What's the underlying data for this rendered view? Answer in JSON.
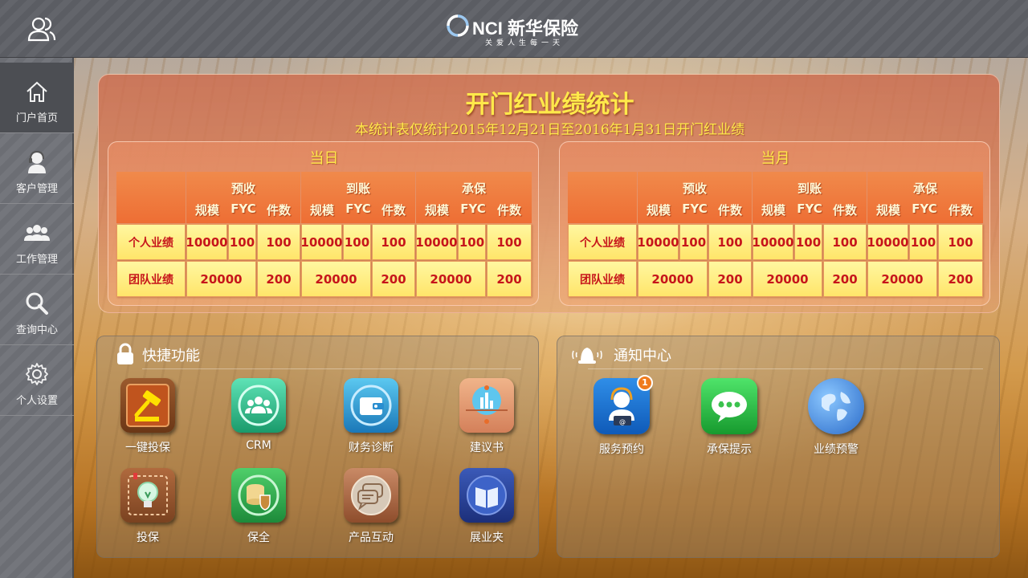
{
  "header": {
    "logo_text": "NCI 新华保险",
    "logo_tagline": "关爱人生每一天"
  },
  "sidebar": {
    "items": [
      {
        "label": "门户首页",
        "icon": "home-icon",
        "active": true
      },
      {
        "label": "客户管理",
        "icon": "customer-service-icon",
        "active": false
      },
      {
        "label": "工作管理",
        "icon": "team-icon",
        "active": false
      },
      {
        "label": "查询中心",
        "icon": "search-icon",
        "active": false
      },
      {
        "label": "个人设置",
        "icon": "gear-icon",
        "active": false
      }
    ]
  },
  "stats": {
    "title": "开门红业绩统计",
    "subtitle": "本统计表仅统计2015年12月21日至2016年1月31日开门红业绩",
    "header_groups": [
      "预收",
      "到账",
      "承保"
    ],
    "header_cols": [
      "规模",
      "FYC",
      "件数"
    ],
    "panels": [
      {
        "title": "当日",
        "rows": [
          {
            "label": "个人业绩",
            "values": [
              "10000",
              "100",
              "100",
              "10000",
              "100",
              "100",
              "10000",
              "100",
              "100"
            ]
          },
          {
            "label": "团队业绩",
            "values": [
              "20000",
              "200",
              "20000",
              "200",
              "20000",
              "200"
            ]
          }
        ]
      },
      {
        "title": "当月",
        "rows": [
          {
            "label": "个人业绩",
            "values": [
              "10000",
              "100",
              "100",
              "10000",
              "100",
              "100",
              "10000",
              "100",
              "100"
            ]
          },
          {
            "label": "团队业绩",
            "values": [
              "20000",
              "200",
              "20000",
              "200",
              "20000",
              "200"
            ]
          }
        ]
      }
    ]
  },
  "quick": {
    "title": "快捷功能",
    "tiles": [
      {
        "label": "一键投保",
        "icon": "gavel-icon"
      },
      {
        "label": "CRM",
        "icon": "crm-people-icon"
      },
      {
        "label": "财务诊断",
        "icon": "wallet-icon"
      },
      {
        "label": "建议书",
        "icon": "chart-folder-icon"
      },
      {
        "label": "投保",
        "icon": "lightbulb-icon"
      },
      {
        "label": "保全",
        "icon": "shield-database-icon"
      },
      {
        "label": "产品互动",
        "icon": "chat-bubbles-icon"
      },
      {
        "label": "展业夹",
        "icon": "book-icon"
      }
    ]
  },
  "notice": {
    "title": "通知中心",
    "tiles": [
      {
        "label": "服务预约",
        "icon": "service-agent-icon",
        "badge": "1"
      },
      {
        "label": "承保提示",
        "icon": "message-bubble-icon"
      },
      {
        "label": "业绩预警",
        "icon": "globe-icon"
      }
    ]
  }
}
